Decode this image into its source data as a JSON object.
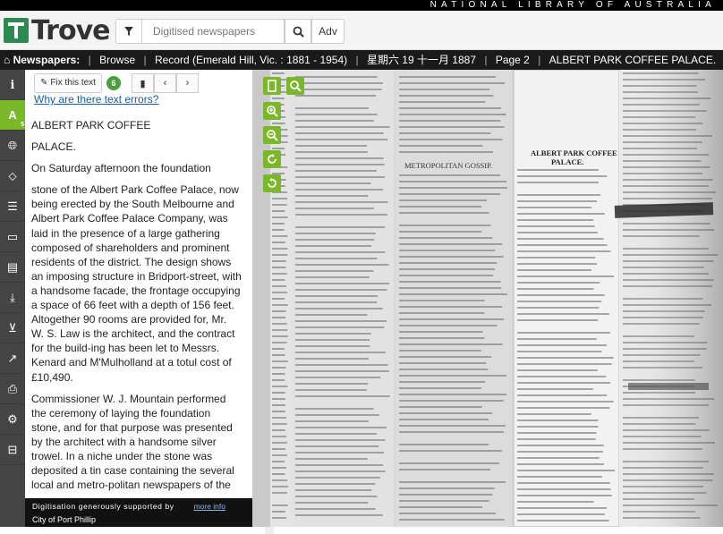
{
  "top": {
    "org": "NATIONAL LIBRARY OF AUSTRALIA"
  },
  "header": {
    "logo_text": "Trove",
    "search_placeholder": "Digitised newspapers",
    "adv_label": "Adv"
  },
  "breadcrumb": {
    "home": "Newspapers:",
    "items": [
      "Browse",
      "Record (Emerald Hill, Vic. : 1881 - 1954)",
      "星期六 19 十一月 1887",
      "Page 2",
      "ALBERT PARK COFFEE PALACE."
    ]
  },
  "sidebar": {
    "items": [
      {
        "icon": "info-icon",
        "label": ""
      },
      {
        "icon": "text-icon",
        "label": "A",
        "sub": "5"
      },
      {
        "icon": "globe-icon",
        "label": ""
      },
      {
        "icon": "tag-icon",
        "label": ""
      },
      {
        "icon": "list-icon",
        "label": ""
      },
      {
        "icon": "comment-icon",
        "label": ""
      },
      {
        "icon": "folder-icon",
        "label": ""
      },
      {
        "icon": "download-icon",
        "label": ""
      },
      {
        "icon": "cart-icon",
        "label": ""
      },
      {
        "icon": "share-icon",
        "label": ""
      },
      {
        "icon": "print-icon",
        "label": ""
      },
      {
        "icon": "gear-icon",
        "label": ""
      },
      {
        "icon": "collapse-icon",
        "label": ""
      }
    ]
  },
  "textpanel": {
    "fix_label": "Fix this text",
    "fix_count": "6",
    "why_link": "Why are there text errors?",
    "paragraphs": [
      "ALBERT PARK COFFEE",
      "PALACE.",
      "On Saturday afternoon the foundation",
      "stone of the Albert Park Coffee Palace, now being erected by the South Melbourne and Albert Park Coffee Palace Company, was laid in the presence of a large gathering composed of shareholders and prominent residents of the district. The design shows an imposing structure in Bridport-street, with a handsome facade, the frontage occupying a space of 66 feet with a depth of 156 feet. Altogether 90 rooms are provided for, Mr. W. S. Law is the architect, and the contract for the build-ing has been let to Messrs. Kenard and M'Mulholland at a totul cost of £10,490.",
      "Commissioner W. J. Mountain performed the ceremony of laying the foundation stone, and for that purpose was presented by the architect with a handsome silver trowel. In a niche under the stone was deposited a tin case containing the several local and metro-politan newspapers of the day, and the various coins from 1d up to a sovereign. The stone was then lowered into its position, and was"
    ],
    "digitisation": "Digitisation generously supported by",
    "more_info": "more info",
    "sponsor": "City of Port Phillip"
  },
  "viewer": {
    "headline_1": "METROPOLITAN GOSSIP.",
    "headline_2": "ALBERT PARK COFFEE",
    "headline_3": "PALACE."
  },
  "colors": {
    "accent": "#7ab82a",
    "brand": "#2f8a52",
    "link": "#1a5fa0"
  }
}
